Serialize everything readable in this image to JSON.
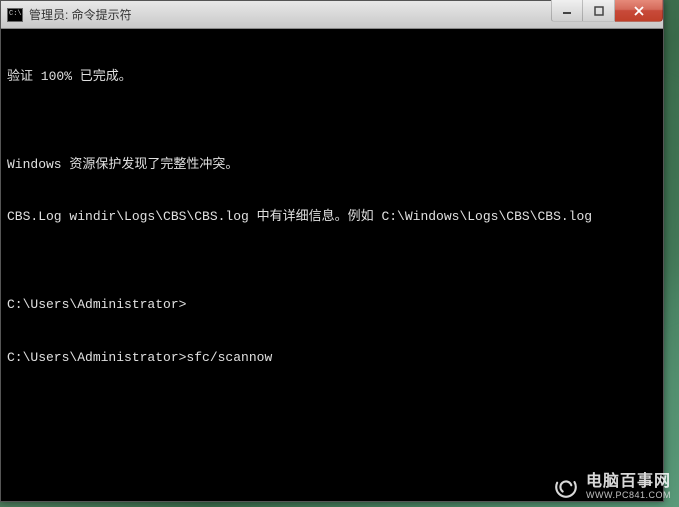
{
  "window": {
    "title": "管理员: 命令提示符",
    "icon_text": "C:\\."
  },
  "terminal": {
    "lines": [
      "验证 100% 已完成。",
      "",
      "Windows 资源保护发现了完整性冲突。",
      "CBS.Log windir\\Logs\\CBS\\CBS.log 中有详细信息。例如 C:\\Windows\\Logs\\CBS\\CBS.log",
      "",
      "C:\\Users\\Administrator>",
      "C:\\Users\\Administrator>sfc/scannow"
    ]
  },
  "watermark": {
    "main": "电脑百事网",
    "sub": "WWW.PC841.COM"
  }
}
